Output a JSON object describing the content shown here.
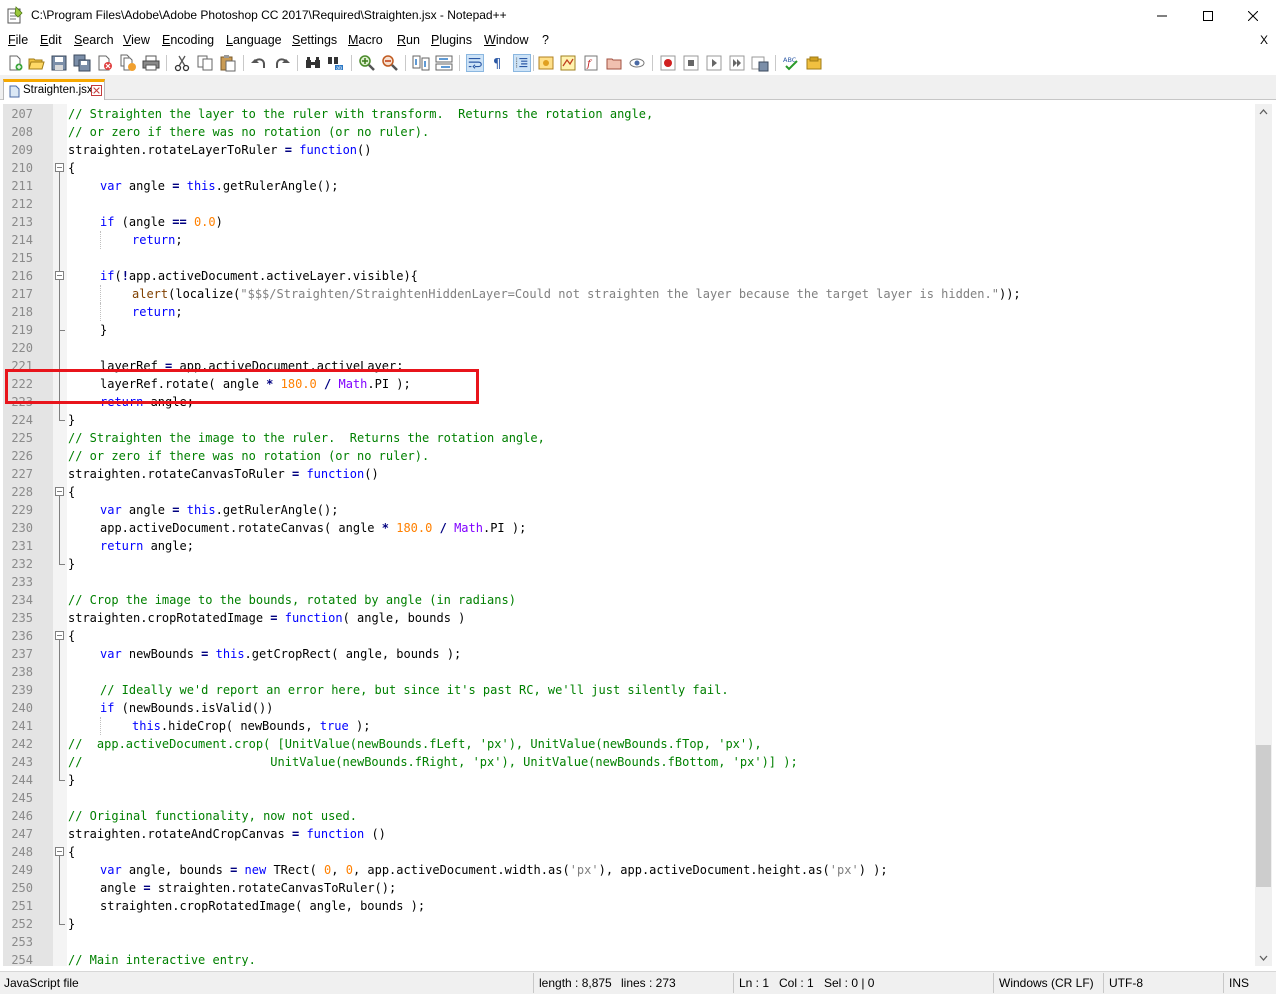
{
  "window": {
    "title": "C:\\Program Files\\Adobe\\Adobe Photoshop CC 2017\\Required\\Straighten.jsx - Notepad++",
    "minimize_icon": "minimize-icon",
    "maximize_icon": "maximize-icon",
    "close_icon": "close-icon"
  },
  "menu": {
    "items": [
      "File",
      "Edit",
      "Search",
      "View",
      "Encoding",
      "Language",
      "Settings",
      "Macro",
      "Run",
      "Plugins",
      "Window",
      "?"
    ],
    "close_label": "X"
  },
  "toolbar": {
    "icons": [
      "new-file-icon",
      "open-file-icon",
      "save-icon",
      "save-all-icon",
      "close-file-icon",
      "close-all-icon",
      "print-icon",
      "cut-icon",
      "copy-icon",
      "paste-icon",
      "undo-icon",
      "redo-icon",
      "find-icon",
      "replace-icon",
      "zoom-in-icon",
      "zoom-out-icon",
      "sync-vertical-icon",
      "sync-horizontal-icon",
      "word-wrap-icon",
      "show-all-characters-icon",
      "indent-guide-icon",
      "user-language-icon",
      "document-map-icon",
      "function-list-icon",
      "folder-as-workspace-icon",
      "monitoring-icon",
      "record-macro-icon",
      "stop-recording-icon",
      "play-macro-icon",
      "run-macro-multiple-icon",
      "save-macro-icon",
      "spell-check-icon",
      "plugin-icon"
    ]
  },
  "tab": {
    "label": "Straighten.jsx",
    "icon": "file-icon",
    "close_icon": "tab-close-icon"
  },
  "editor": {
    "lines": [
      {
        "n": "207",
        "indent": 0,
        "t": [
          [
            "// Straighten the layer to the ruler with transform.  Returns the rotation angle,",
            "comment"
          ]
        ]
      },
      {
        "n": "208",
        "indent": 0,
        "t": [
          [
            "// or zero if there was no rotation (or no ruler).",
            "comment"
          ]
        ]
      },
      {
        "n": "209",
        "indent": 0,
        "t": [
          [
            "straighten.rotateLayerToRuler ",
            "plain"
          ],
          [
            "=",
            "op"
          ],
          [
            " ",
            "plain"
          ],
          [
            "function",
            "keyword"
          ],
          [
            "()",
            "plain"
          ]
        ]
      },
      {
        "n": "210",
        "indent": 0,
        "t": [
          [
            "{",
            "plain"
          ]
        ]
      },
      {
        "n": "211",
        "indent": 1,
        "t": [
          [
            "var",
            "keyword"
          ],
          [
            " angle ",
            "plain"
          ],
          [
            "=",
            "op"
          ],
          [
            " ",
            "plain"
          ],
          [
            "this",
            "keyword"
          ],
          [
            ".getRulerAngle();",
            "plain"
          ]
        ]
      },
      {
        "n": "212",
        "indent": 0,
        "t": []
      },
      {
        "n": "213",
        "indent": 1,
        "t": [
          [
            "if",
            "keyword"
          ],
          [
            " (angle ",
            "plain"
          ],
          [
            "==",
            "op"
          ],
          [
            " ",
            "plain"
          ],
          [
            "0.0",
            "number"
          ],
          [
            ")",
            "plain"
          ]
        ]
      },
      {
        "n": "214",
        "indent": 2,
        "t": [
          [
            "return",
            "keyword"
          ],
          [
            ";",
            "plain"
          ]
        ]
      },
      {
        "n": "215",
        "indent": 0,
        "t": []
      },
      {
        "n": "216",
        "indent": 1,
        "t": [
          [
            "if",
            "keyword"
          ],
          [
            "(",
            "plain"
          ],
          [
            "!",
            "op"
          ],
          [
            "app.activeDocument.activeLayer.visible){",
            "plain"
          ]
        ]
      },
      {
        "n": "217",
        "indent": 2,
        "t": [
          [
            "alert",
            "alert"
          ],
          [
            "(localize(",
            "plain"
          ],
          [
            "\"$$$/Straighten/StraightenHiddenLayer=Could not straighten the layer because the target layer is hidden.\"",
            "string"
          ],
          [
            "));",
            "plain"
          ]
        ]
      },
      {
        "n": "218",
        "indent": 2,
        "t": [
          [
            "return",
            "keyword"
          ],
          [
            ";",
            "plain"
          ]
        ]
      },
      {
        "n": "219",
        "indent": 1,
        "t": [
          [
            "}",
            "plain"
          ]
        ]
      },
      {
        "n": "220",
        "indent": 0,
        "t": []
      },
      {
        "n": "221",
        "indent": 1,
        "t": [
          [
            "layerRef ",
            "plain"
          ],
          [
            "=",
            "op"
          ],
          [
            " app.activeDocument.activeLayer;",
            "plain"
          ]
        ]
      },
      {
        "n": "222",
        "indent": 1,
        "t": [
          [
            "layerRef.rotate( angle ",
            "plain"
          ],
          [
            "*",
            "op"
          ],
          [
            " ",
            "plain"
          ],
          [
            "180.0",
            "number"
          ],
          [
            " ",
            "plain"
          ],
          [
            "/",
            "op"
          ],
          [
            " ",
            "plain"
          ],
          [
            "Math",
            "builtin"
          ],
          [
            ".PI );",
            "plain"
          ]
        ]
      },
      {
        "n": "223",
        "indent": 1,
        "t": [
          [
            "return",
            "keyword"
          ],
          [
            " angle;",
            "plain"
          ]
        ]
      },
      {
        "n": "224",
        "indent": 0,
        "t": [
          [
            "}",
            "plain"
          ]
        ]
      },
      {
        "n": "225",
        "indent": 0,
        "t": [
          [
            "// Straighten the image to the ruler.  Returns the rotation angle,",
            "comment"
          ]
        ]
      },
      {
        "n": "226",
        "indent": 0,
        "t": [
          [
            "// or zero if there was no rotation (or no ruler).",
            "comment"
          ]
        ]
      },
      {
        "n": "227",
        "indent": 0,
        "t": [
          [
            "straighten.rotateCanvasToRuler ",
            "plain"
          ],
          [
            "=",
            "op"
          ],
          [
            " ",
            "plain"
          ],
          [
            "function",
            "keyword"
          ],
          [
            "()",
            "plain"
          ]
        ]
      },
      {
        "n": "228",
        "indent": 0,
        "t": [
          [
            "{",
            "plain"
          ]
        ]
      },
      {
        "n": "229",
        "indent": 1,
        "t": [
          [
            "var",
            "keyword"
          ],
          [
            " angle ",
            "plain"
          ],
          [
            "=",
            "op"
          ],
          [
            " ",
            "plain"
          ],
          [
            "this",
            "keyword"
          ],
          [
            ".getRulerAngle();",
            "plain"
          ]
        ]
      },
      {
        "n": "230",
        "indent": 1,
        "t": [
          [
            "app.activeDocument.rotateCanvas( angle ",
            "plain"
          ],
          [
            "*",
            "op"
          ],
          [
            " ",
            "plain"
          ],
          [
            "180.0",
            "number"
          ],
          [
            " ",
            "plain"
          ],
          [
            "/",
            "op"
          ],
          [
            " ",
            "plain"
          ],
          [
            "Math",
            "builtin"
          ],
          [
            ".PI );",
            "plain"
          ]
        ]
      },
      {
        "n": "231",
        "indent": 1,
        "t": [
          [
            "return",
            "keyword"
          ],
          [
            " angle;",
            "plain"
          ]
        ]
      },
      {
        "n": "232",
        "indent": 0,
        "t": [
          [
            "}",
            "plain"
          ]
        ]
      },
      {
        "n": "233",
        "indent": 0,
        "t": []
      },
      {
        "n": "234",
        "indent": 0,
        "t": [
          [
            "// Crop the image to the bounds, rotated by angle (in radians)",
            "comment"
          ]
        ]
      },
      {
        "n": "235",
        "indent": 0,
        "t": [
          [
            "straighten.cropRotatedImage ",
            "plain"
          ],
          [
            "=",
            "op"
          ],
          [
            " ",
            "plain"
          ],
          [
            "function",
            "keyword"
          ],
          [
            "( angle, bounds )",
            "plain"
          ]
        ]
      },
      {
        "n": "236",
        "indent": 0,
        "t": [
          [
            "{",
            "plain"
          ]
        ]
      },
      {
        "n": "237",
        "indent": 1,
        "t": [
          [
            "var",
            "keyword"
          ],
          [
            " newBounds ",
            "plain"
          ],
          [
            "=",
            "op"
          ],
          [
            " ",
            "plain"
          ],
          [
            "this",
            "keyword"
          ],
          [
            ".getCropRect( angle, bounds );",
            "plain"
          ]
        ]
      },
      {
        "n": "238",
        "indent": 0,
        "t": []
      },
      {
        "n": "239",
        "indent": 1,
        "t": [
          [
            "// Ideally we'd report an error here, but since it's past RC, we'll just silently fail.",
            "comment"
          ]
        ]
      },
      {
        "n": "240",
        "indent": 1,
        "t": [
          [
            "if",
            "keyword"
          ],
          [
            " (newBounds.isValid())",
            "plain"
          ]
        ]
      },
      {
        "n": "241",
        "indent": 2,
        "t": [
          [
            "this",
            "keyword"
          ],
          [
            ".hideCrop( newBounds, ",
            "plain"
          ],
          [
            "true",
            "keyword"
          ],
          [
            " );",
            "plain"
          ]
        ]
      },
      {
        "n": "242",
        "indent": 0,
        "t": [
          [
            "//  app.activeDocument.crop( [UnitValue(newBounds.fLeft, 'px'), UnitValue(newBounds.fTop, 'px'),",
            "comment"
          ]
        ]
      },
      {
        "n": "243",
        "indent": 0,
        "t": [
          [
            "//                          UnitValue(newBounds.fRight, 'px'), UnitValue(newBounds.fBottom, 'px')] );",
            "comment"
          ]
        ]
      },
      {
        "n": "244",
        "indent": 0,
        "t": [
          [
            "}",
            "plain"
          ]
        ]
      },
      {
        "n": "245",
        "indent": 0,
        "t": []
      },
      {
        "n": "246",
        "indent": 0,
        "t": [
          [
            "// Original functionality, now not used.",
            "comment"
          ]
        ]
      },
      {
        "n": "247",
        "indent": 0,
        "t": [
          [
            "straighten.rotateAndCropCanvas ",
            "plain"
          ],
          [
            "=",
            "op"
          ],
          [
            " ",
            "plain"
          ],
          [
            "function",
            "keyword"
          ],
          [
            " ()",
            "plain"
          ]
        ]
      },
      {
        "n": "248",
        "indent": 0,
        "t": [
          [
            "{",
            "plain"
          ]
        ]
      },
      {
        "n": "249",
        "indent": 1,
        "t": [
          [
            "var",
            "keyword"
          ],
          [
            " angle, bounds ",
            "plain"
          ],
          [
            "=",
            "op"
          ],
          [
            " ",
            "plain"
          ],
          [
            "new",
            "keyword"
          ],
          [
            " TRect( ",
            "plain"
          ],
          [
            "0",
            "number"
          ],
          [
            ", ",
            "plain"
          ],
          [
            "0",
            "number"
          ],
          [
            ", app.activeDocument.width.as(",
            "plain"
          ],
          [
            "'px'",
            "string"
          ],
          [
            "), app.activeDocument.height.as(",
            "plain"
          ],
          [
            "'px'",
            "string"
          ],
          [
            ") );",
            "plain"
          ]
        ]
      },
      {
        "n": "250",
        "indent": 1,
        "t": [
          [
            "angle ",
            "plain"
          ],
          [
            "=",
            "op"
          ],
          [
            " straighten.rotateCanvasToRuler();",
            "plain"
          ]
        ]
      },
      {
        "n": "251",
        "indent": 1,
        "t": [
          [
            "straighten.cropRotatedImage( angle, bounds );",
            "plain"
          ]
        ]
      },
      {
        "n": "252",
        "indent": 0,
        "t": [
          [
            "}",
            "plain"
          ]
        ]
      },
      {
        "n": "253",
        "indent": 0,
        "t": []
      },
      {
        "n": "254",
        "indent": 0,
        "t": [
          [
            "// Main interactive entry.",
            "comment"
          ]
        ]
      }
    ],
    "folds": [
      {
        "open": "210",
        "close": "224"
      },
      {
        "open": "216",
        "close": "219"
      },
      {
        "open": "228",
        "close": "232"
      },
      {
        "open": "236",
        "close": "244"
      },
      {
        "open": "248",
        "close": "252"
      }
    ],
    "highlight_line": "222"
  },
  "scrollbar": {
    "up_icon": "scroll-up-arrow-icon",
    "down_icon": "scroll-down-arrow-icon"
  },
  "status": {
    "file_type": "JavaScript file",
    "length": "length : 8,875",
    "lines": "lines : 273",
    "ln": "Ln : 1",
    "col": "Col : 1",
    "sel": "Sel : 0 | 0",
    "eol": "Windows (CR LF)",
    "encoding": "UTF-8",
    "mode": "INS"
  },
  "colors": {
    "comment": "#008000",
    "keyword": "#0000ff",
    "number": "#ff8000",
    "string": "#808080",
    "builtin": "#8000ff",
    "highlight_box": "#e8141b",
    "tab_accent": "#f6a800"
  }
}
